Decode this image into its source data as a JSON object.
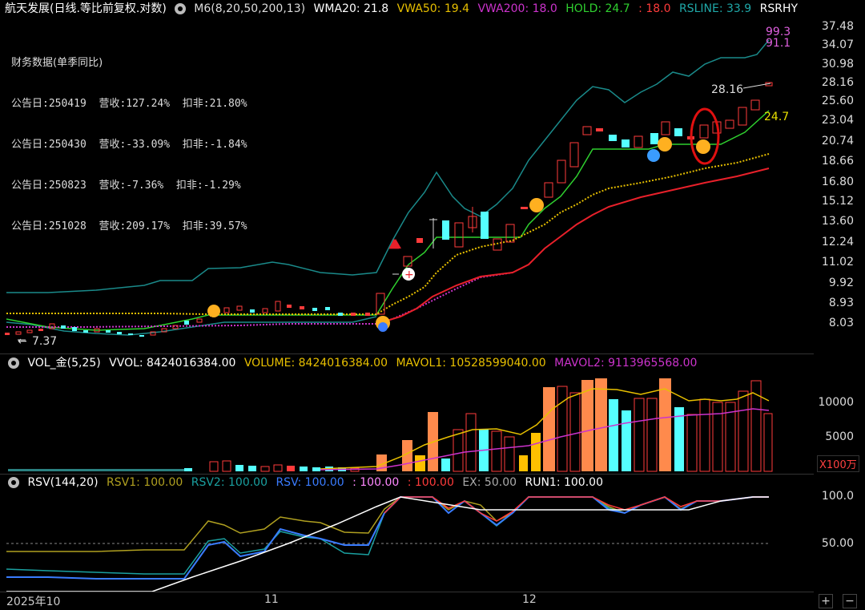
{
  "main_header": {
    "title": "航天发展(日线.等比前复权.对数)",
    "m6": "M6(8,20,50,200,13)",
    "wma20": "WMA20: 21.8",
    "vwa50": "VWA50: 19.4",
    "vwa200": "VWA200: 18.0",
    "hold": "HOLD: 24.7",
    "hold2": ": 18.0",
    "rsline": "RSLINE: 33.9",
    "rsrhy": "RSRHY"
  },
  "financial": {
    "title": "财务数据(单季同比)",
    "rows": [
      {
        "label": "公告日:",
        "date": "250419",
        "rev_label": "营收:",
        "rev": "127.24%",
        "ex_label": "扣非:",
        "ex": "21.80%"
      },
      {
        "label": "公告日:",
        "date": "250430",
        "rev_label": "营收:",
        "rev": "-33.09%",
        "ex_label": "扣非:",
        "ex": "-1.84%"
      },
      {
        "label": "公告日:",
        "date": "250823",
        "rev_label": "营收:",
        "rev": "-7.36%",
        "ex_label": "扣非:",
        "ex": "-1.29%"
      },
      {
        "label": "公告日:",
        "date": "251028",
        "rev_label": "营收:",
        "rev": "209.17%",
        "ex_label": "扣非:",
        "ex": "39.57%"
      }
    ]
  },
  "price_axis": [
    "37.48",
    "34.07",
    "30.98",
    "28.16",
    "25.60",
    "23.04",
    "20.74",
    "18.66",
    "16.80",
    "15.12",
    "13.60",
    "12.24",
    "11.02",
    "9.92",
    "8.93",
    "8.03"
  ],
  "annotations": {
    "low": "7.37",
    "high": "28.16",
    "hold_val": "24.7",
    "rs_val1": "99.3",
    "rs_val2": "91.1"
  },
  "vol_header": {
    "name": "VOL_金(5,25)",
    "vvol": "VVOL: 8424016384.00",
    "volume": "VOLUME: 8424016384.00",
    "mavol1": "MAVOL1: 10528599040.00",
    "mavol2": "MAVOL2: 9113965568.00"
  },
  "vol_axis": [
    "10000",
    "5000"
  ],
  "vol_unit": "X100万",
  "rsv_header": {
    "name": "RSV(144,20)",
    "rsv1": "RSV1: 100.00",
    "rsv2": "RSV2: 100.00",
    "rsv": "RSV: 100.00",
    "a": ": 100.00",
    "b": ": 100.00",
    "ex": "EX: 50.00",
    "run1": "RUN1: 100.00"
  },
  "rsv_axis": [
    "100.0",
    "50.00"
  ],
  "x_labels": [
    "2025年10",
    "11",
    "12"
  ],
  "controls": {
    "zoom_in": "+",
    "zoom_out": "−"
  },
  "colors": {
    "up": "#ff3b3b",
    "down": "#55ffff",
    "ma_green": "#2fd02f",
    "ma_yellow": "#e8c000",
    "ma_red": "#e8202a",
    "ma_purple": "#cc33cc",
    "band": "#1a8a8a",
    "vol_orange": "#ff8a4c",
    "vol_yellow": "#ffc000"
  }
}
